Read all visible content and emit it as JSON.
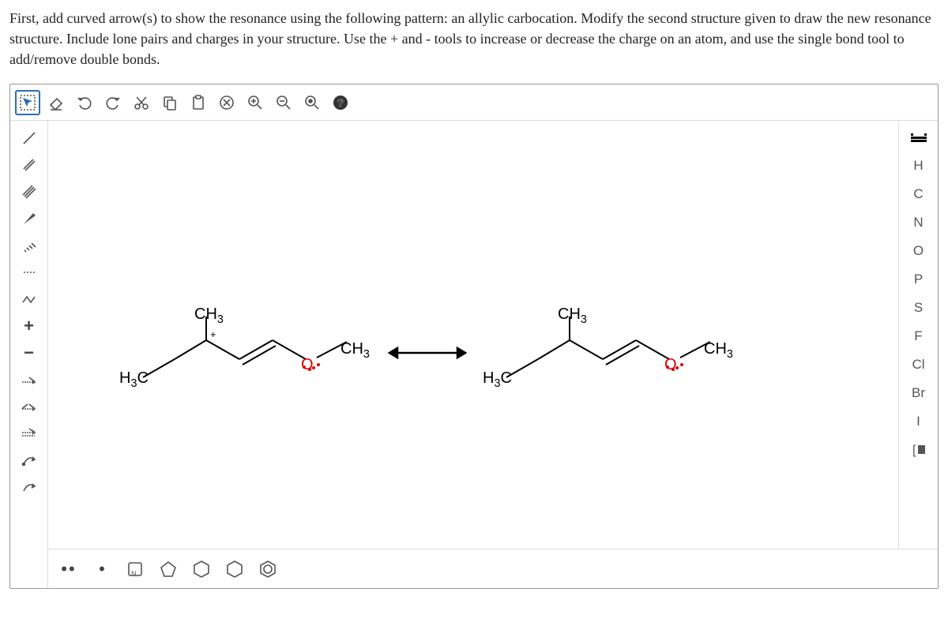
{
  "instructions": "First, add curved arrow(s) to show the resonance using the following pattern: an allylic carbocation. Modify the second structure given to draw the new resonance structure. Include lone pairs and charges in your structure. Use the + and - tools to increase or decrease the charge on an atom, and use the single bond tool to add/remove double bonds.",
  "atoms": {
    "h": "H",
    "c": "C",
    "n": "N",
    "o": "O",
    "p": "P",
    "s": "S",
    "f": "F",
    "cl": "Cl",
    "br": "Br",
    "i": "I"
  },
  "charge_plus": "+",
  "charge_minus": "−",
  "labels": {
    "ch3": "CH",
    "ch3_sub": "3",
    "h3c": "H",
    "h3c_sub": "3",
    "h3c_c": "C",
    "o": "O"
  },
  "plus_charge": "+"
}
